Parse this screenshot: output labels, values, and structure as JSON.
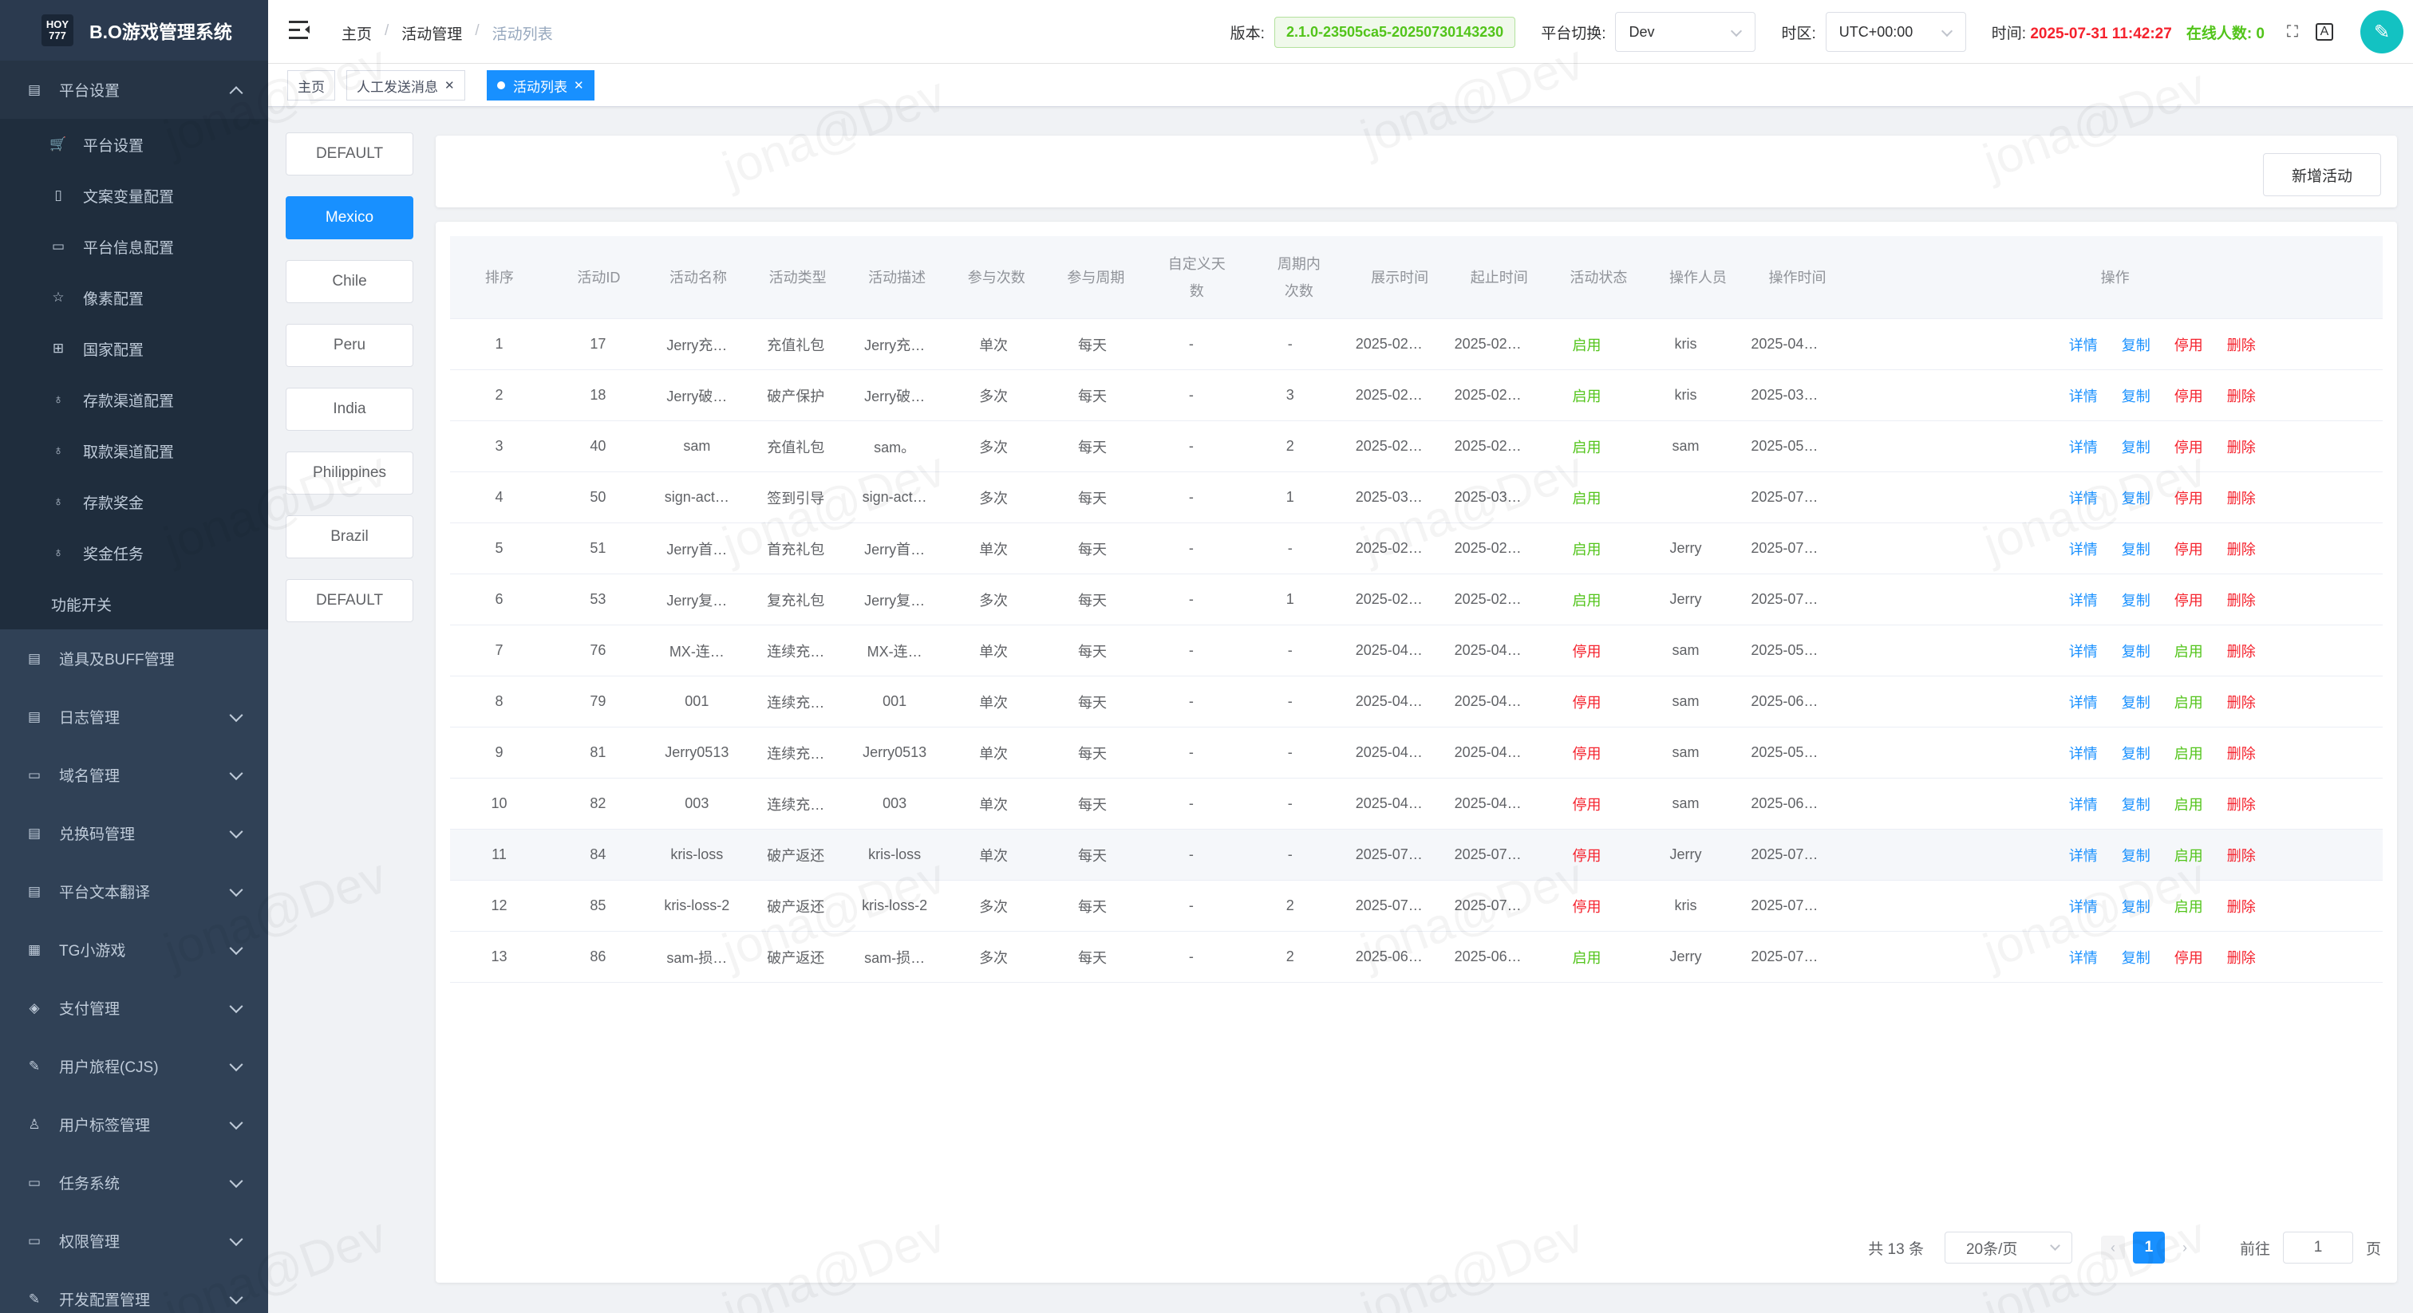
{
  "app": {
    "logo_text": "HOY\n777",
    "title": "B.O游戏管理系统"
  },
  "sidebar": {
    "items": [
      {
        "label": "平台设置",
        "icon": "store-icon",
        "type": "parent-open"
      },
      {
        "label": "平台设置",
        "icon": "cart-icon",
        "type": "sub"
      },
      {
        "label": "文案变量配置",
        "icon": "document-icon",
        "type": "sub"
      },
      {
        "label": "平台信息配置",
        "icon": "monitor-icon",
        "type": "sub"
      },
      {
        "label": "像素配置",
        "icon": "star-icon",
        "type": "sub"
      },
      {
        "label": "国家配置",
        "icon": "org-icon",
        "type": "sub"
      },
      {
        "label": "存款渠道配置",
        "icon": "money-bag-icon",
        "type": "sub"
      },
      {
        "label": "取款渠道配置",
        "icon": "money-bag-icon",
        "type": "sub"
      },
      {
        "label": "存款奖金",
        "icon": "money-bag-icon",
        "type": "sub"
      },
      {
        "label": "奖金任务",
        "icon": "money-bag-icon",
        "type": "sub"
      },
      {
        "label": "功能开关",
        "icon": "",
        "type": "plain"
      },
      {
        "label": "道具及BUFF管理",
        "icon": "clipboard-icon",
        "type": "top"
      },
      {
        "label": "日志管理",
        "icon": "log-icon",
        "type": "top-collapsed"
      },
      {
        "label": "域名管理",
        "icon": "monitor-icon",
        "type": "top-collapsed"
      },
      {
        "label": "兑换码管理",
        "icon": "store-icon",
        "type": "top-collapsed"
      },
      {
        "label": "平台文本翻译",
        "icon": "store-icon",
        "type": "top-collapsed"
      },
      {
        "label": "TG小游戏",
        "icon": "game-icon",
        "type": "top-collapsed"
      },
      {
        "label": "支付管理",
        "icon": "layers-icon",
        "type": "top-collapsed"
      },
      {
        "label": "用户旅程(CJS)",
        "icon": "edit-icon",
        "type": "top-collapsed"
      },
      {
        "label": "用户标签管理",
        "icon": "user-icon",
        "type": "top-collapsed"
      },
      {
        "label": "任务系统",
        "icon": "monitor-icon",
        "type": "top-collapsed"
      },
      {
        "label": "权限管理",
        "icon": "laptop-icon",
        "type": "top-collapsed"
      },
      {
        "label": "开发配置管理",
        "icon": "edit-icon",
        "type": "top-collapsed"
      }
    ]
  },
  "navbar": {
    "breadcrumb": [
      "主页",
      "活动管理",
      "活动列表"
    ],
    "version_label": "版本:",
    "version_value": "2.1.0-23505ca5-20250730143230",
    "platform_label": "平台切换:",
    "platform_value": "Dev",
    "timezone_label": "时区:",
    "timezone_value": "UTC+00:00",
    "time_label": "时间:",
    "time_value": "2025-07-31 11:42:27",
    "online_label": "在线人数:",
    "online_value": "0"
  },
  "tags": [
    {
      "label": "主页",
      "closable": false,
      "active": false
    },
    {
      "label": "人工发送消息",
      "closable": true,
      "active": false
    },
    {
      "label": "活动列表",
      "closable": true,
      "active": true
    }
  ],
  "platforms": [
    {
      "label": "DEFAULT",
      "active": false
    },
    {
      "label": "Mexico",
      "active": true
    },
    {
      "label": "Chile",
      "active": false
    },
    {
      "label": "Peru",
      "active": false
    },
    {
      "label": "India",
      "active": false
    },
    {
      "label": "Philippines",
      "active": false
    },
    {
      "label": "Brazil",
      "active": false
    },
    {
      "label": "DEFAULT",
      "active": false
    }
  ],
  "actions": {
    "add_label": "新增活动"
  },
  "table": {
    "headers": [
      "排序",
      "活动ID",
      "活动名称",
      "活动类型",
      "活动描述",
      "参与次数",
      "参与周期",
      "自定义天数",
      "周期内次数",
      "展示时间",
      "起止时间",
      "活动状态",
      "操作人员",
      "操作时间",
      "操作"
    ],
    "op_labels": {
      "detail": "详情",
      "copy": "复制",
      "disable": "停用",
      "enable": "启用",
      "delete": "删除"
    },
    "rows": [
      [
        "1",
        "17",
        "Jerry充…",
        "充值礼包",
        "Jerry充…",
        "单次",
        "每天",
        "-",
        "-",
        "2025-02…",
        "2025-02…",
        "启用",
        "kris",
        "2025-04…"
      ],
      [
        "2",
        "18",
        "Jerry破…",
        "破产保护",
        "Jerry破…",
        "多次",
        "每天",
        "-",
        "3",
        "2025-02…",
        "2025-02…",
        "启用",
        "kris",
        "2025-03…"
      ],
      [
        "3",
        "40",
        "sam",
        "充值礼包",
        "sam。",
        "多次",
        "每天",
        "-",
        "2",
        "2025-02…",
        "2025-02…",
        "启用",
        "sam",
        "2025-05…"
      ],
      [
        "4",
        "50",
        "sign-act…",
        "签到引导",
        "sign-act…",
        "多次",
        "每天",
        "-",
        "1",
        "2025-03…",
        "2025-03…",
        "启用",
        "",
        "2025-07…"
      ],
      [
        "5",
        "51",
        "Jerry首…",
        "首充礼包",
        "Jerry首…",
        "单次",
        "每天",
        "-",
        "-",
        "2025-02…",
        "2025-02…",
        "启用",
        "Jerry",
        "2025-07…"
      ],
      [
        "6",
        "53",
        "Jerry复…",
        "复充礼包",
        "Jerry复…",
        "多次",
        "每天",
        "-",
        "1",
        "2025-02…",
        "2025-02…",
        "启用",
        "Jerry",
        "2025-07…"
      ],
      [
        "7",
        "76",
        "MX-连…",
        "连续充…",
        "MX-连…",
        "单次",
        "每天",
        "-",
        "-",
        "2025-04…",
        "2025-04…",
        "停用",
        "sam",
        "2025-05…"
      ],
      [
        "8",
        "79",
        "001",
        "连续充…",
        "001",
        "单次",
        "每天",
        "-",
        "-",
        "2025-04…",
        "2025-04…",
        "停用",
        "sam",
        "2025-06…"
      ],
      [
        "9",
        "81",
        "Jerry0513",
        "连续充…",
        "Jerry0513",
        "单次",
        "每天",
        "-",
        "-",
        "2025-04…",
        "2025-04…",
        "停用",
        "sam",
        "2025-05…"
      ],
      [
        "10",
        "82",
        "003",
        "连续充…",
        "003",
        "单次",
        "每天",
        "-",
        "-",
        "2025-04…",
        "2025-04…",
        "停用",
        "sam",
        "2025-06…"
      ],
      [
        "11",
        "84",
        "kris-loss",
        "破产返还",
        "kris-loss",
        "单次",
        "每天",
        "-",
        "-",
        "2025-07…",
        "2025-07…",
        "停用",
        "Jerry",
        "2025-07…"
      ],
      [
        "12",
        "85",
        "kris-loss-2",
        "破产返还",
        "kris-loss-2",
        "多次",
        "每天",
        "-",
        "2",
        "2025-07…",
        "2025-07…",
        "停用",
        "kris",
        "2025-07…"
      ],
      [
        "13",
        "86",
        "sam-损…",
        "破产返还",
        "sam-损…",
        "多次",
        "每天",
        "-",
        "2",
        "2025-06…",
        "2025-06…",
        "启用",
        "Jerry",
        "2025-07…"
      ]
    ]
  },
  "pagination": {
    "total_label": "共 13 条",
    "page_size": "20条/页",
    "current_page": "1",
    "goto_label": "前往",
    "goto_value": "1",
    "page_suffix": "页"
  },
  "watermark": "jona@Dev",
  "colors": {
    "sidebar_bg": "#304156",
    "primary": "#1890ff",
    "enabled": "#52c41a",
    "disabled": "#f5222d"
  }
}
